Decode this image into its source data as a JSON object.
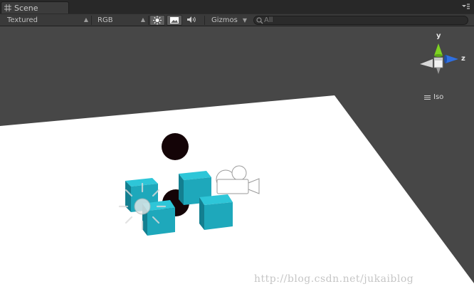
{
  "tab": {
    "label": "Scene"
  },
  "toolbar": {
    "draw_mode": "Textured",
    "render_mode": "RGB",
    "gizmos_label": "Gizmos",
    "search_placeholder": "All"
  },
  "gizmo": {
    "axes": {
      "y": "y",
      "z": "z"
    },
    "projection": "Iso",
    "colors": {
      "y": "#7ed321",
      "z": "#2f6fe0",
      "x": "#b0b0b0"
    }
  },
  "scene": {
    "colors": {
      "background": "#474747",
      "ground": "#ffffff",
      "cube_light": "#2ec6d8",
      "cube_mid": "#1ea8bb",
      "cube_dark": "#137f90",
      "sphere": "#140407"
    }
  },
  "watermark": "http://blog.csdn.net/jukaiblog"
}
